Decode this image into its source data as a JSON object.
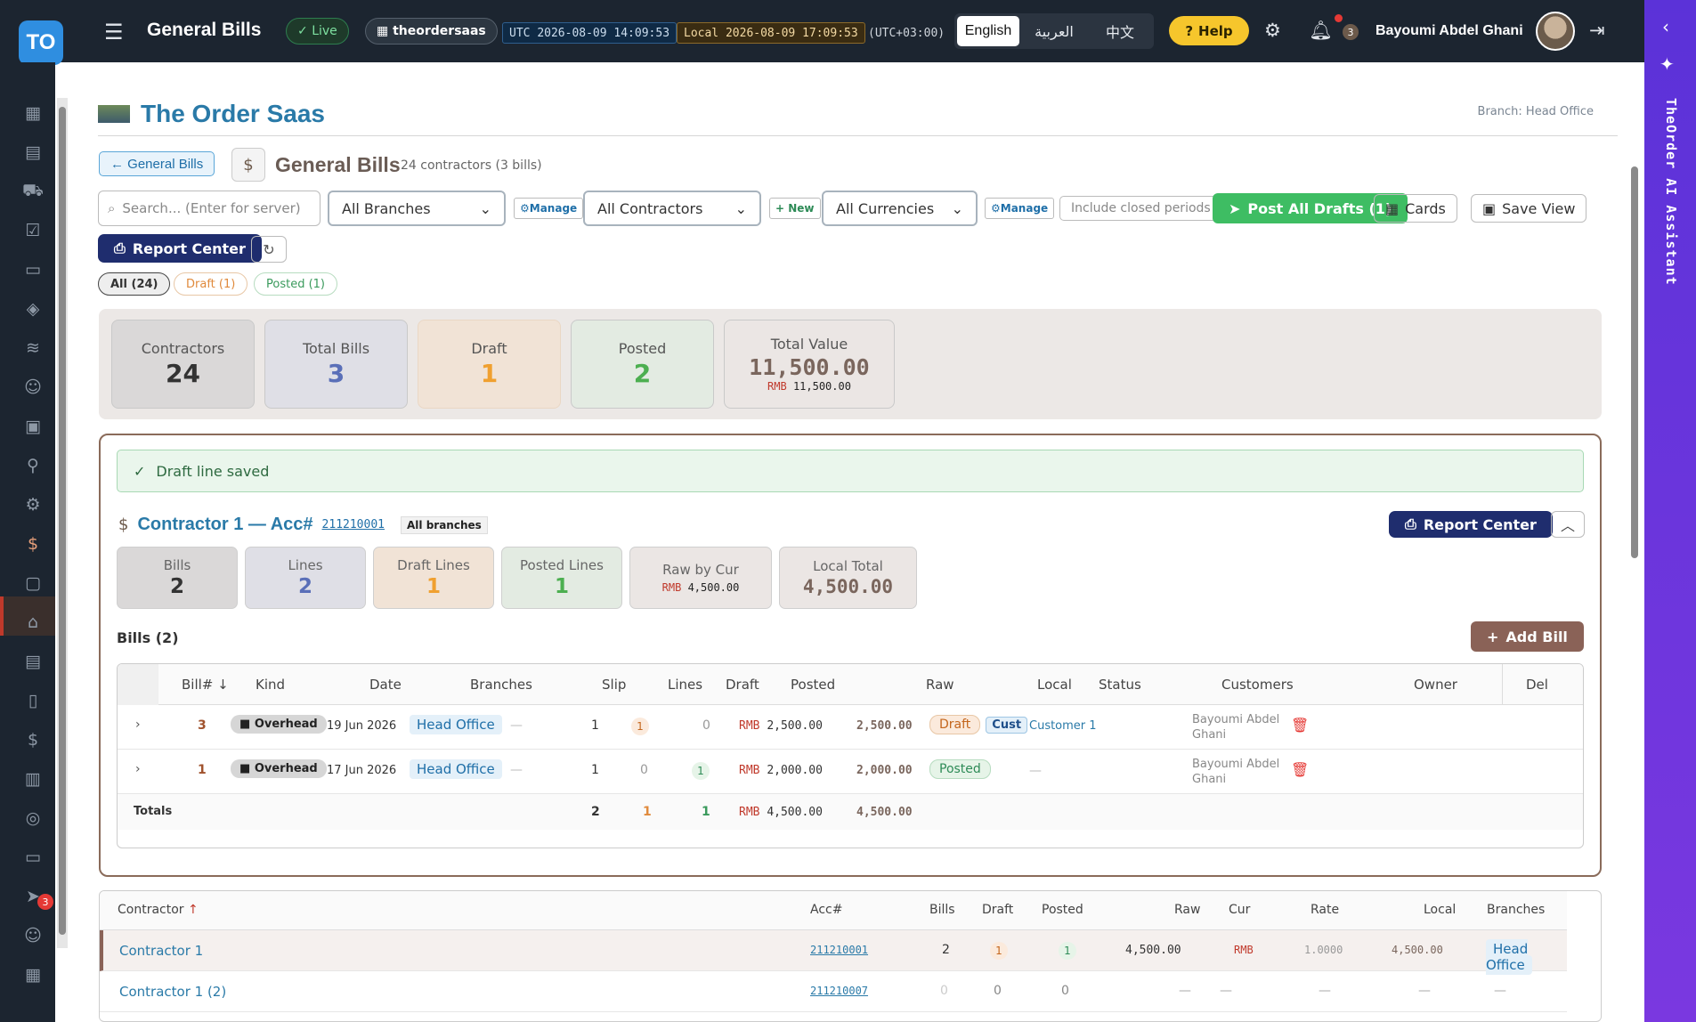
{
  "topbar": {
    "logo": "TO",
    "title": "General Bills",
    "live": "Live",
    "tenant": "theordersaas",
    "utc_label": "UTC",
    "utc_time": "2026-08-09 14:09:53",
    "local_label": "Local",
    "local_time": "2026-08-09 17:09:53",
    "offset": "(UTC+03:00)",
    "languages": [
      "English",
      "العربية",
      "中文"
    ],
    "help": "Help",
    "notif_count": "3",
    "user": "Bayoumi Abdel Ghani"
  },
  "sidebar": {
    "badge": "3"
  },
  "ai_rail": {
    "label": "TheOrder AI Assistant"
  },
  "brand": {
    "name": "The Order Saas",
    "branch": "Branch: Head Office"
  },
  "header": {
    "back": "← General Bills",
    "title": "General Bills",
    "subtitle": "24 contractors (3 bills)"
  },
  "toolbar": {
    "search_placeholder": "Search... (Enter for server)",
    "branches": "All Branches",
    "manage1": "Manage",
    "contractors": "All Contractors",
    "new": "+ New",
    "currencies": "All Currencies",
    "manage2": "Manage",
    "closed": "Include closed periods",
    "post_all": "Post All Drafts (1)",
    "cards": "Cards",
    "save_view": "Save View",
    "report_center": "Report Center"
  },
  "filters": {
    "all": "All (24)",
    "draft": "Draft (1)",
    "posted": "Posted (1)"
  },
  "stats": {
    "contractors_l": "Contractors",
    "contractors_v": "24",
    "bills_l": "Total Bills",
    "bills_v": "3",
    "draft_l": "Draft",
    "draft_v": "1",
    "posted_l": "Posted",
    "posted_v": "2",
    "total_l": "Total Value",
    "total_v": "11,500.00",
    "total_cur": "RMB",
    "total_sub": "11,500.00"
  },
  "panel": {
    "alert": "Draft line saved",
    "contractor": "Contractor 1 — Acc#",
    "acc": "211210001",
    "all_branches": "All branches",
    "report_center": "Report Center",
    "m_bills_l": "Bills",
    "m_bills_v": "2",
    "m_lines_l": "Lines",
    "m_lines_v": "2",
    "m_draft_l": "Draft Lines",
    "m_draft_v": "1",
    "m_posted_l": "Posted Lines",
    "m_posted_v": "1",
    "m_raw_l": "Raw by Cur",
    "m_raw_cur": "RMB",
    "m_raw_v": "4,500.00",
    "m_local_l": "Local Total",
    "m_local_v": "4,500.00",
    "bills_label": "Bills (2)",
    "add_bill": "Add Bill"
  },
  "bills_table": {
    "headers": [
      "Bill#",
      "Kind",
      "Date",
      "Branches",
      "Slip",
      "Lines",
      "Draft",
      "Posted",
      "Raw",
      "Local",
      "Status",
      "Customers",
      "Owner",
      "Del"
    ],
    "rows": [
      {
        "bill": "3",
        "kind": "Overhead",
        "date": "19 Jun 2026",
        "branch": "Head Office",
        "slip": "—",
        "lines": "1",
        "draft": "1",
        "posted": "0",
        "raw_cur": "RMB",
        "raw": "2,500.00",
        "local": "2,500.00",
        "status": "Draft",
        "cust_tag": "Cust",
        "customer": "Customer 1",
        "owner": "Bayoumi Abdel Ghani"
      },
      {
        "bill": "1",
        "kind": "Overhead",
        "date": "17 Jun 2026",
        "branch": "Head Office",
        "slip": "—",
        "lines": "1",
        "draft": "0",
        "posted": "1",
        "raw_cur": "RMB",
        "raw": "2,000.00",
        "local": "2,000.00",
        "status": "Posted",
        "cust_tag": "",
        "customer": "—",
        "owner": "Bayoumi Abdel Ghani"
      }
    ],
    "totals": {
      "label": "Totals",
      "lines": "2",
      "draft": "1",
      "posted": "1",
      "raw_cur": "RMB",
      "raw": "4,500.00",
      "local": "4,500.00"
    }
  },
  "contractors_table": {
    "headers": [
      "Contractor",
      "Acc#",
      "Bills",
      "Draft",
      "Posted",
      "Raw",
      "Cur",
      "Rate",
      "Local",
      "Branches"
    ],
    "rows": [
      {
        "name": "Contractor 1",
        "acc": "211210001",
        "bills": "2",
        "draft": "1",
        "posted": "1",
        "raw": "4,500.00",
        "cur": "RMB",
        "rate": "1.0000",
        "local": "4,500.00",
        "branch": "Head Office"
      },
      {
        "name": "Contractor 1 (2)",
        "acc": "211210007",
        "bills": "0",
        "draft": "0",
        "posted": "0",
        "raw": "—",
        "cur": "—",
        "rate": "—",
        "local": "—",
        "branch": "—"
      }
    ]
  }
}
